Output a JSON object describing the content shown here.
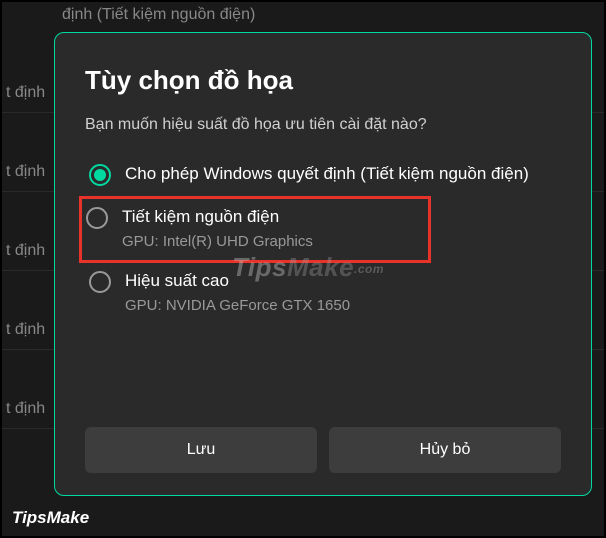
{
  "background": {
    "item0": "định (Tiết kiệm nguồn điện)",
    "item1": "t định",
    "item2": "t định",
    "item3": "t định",
    "item4": "t định",
    "item5": "t định"
  },
  "dialog": {
    "title": "Tùy chọn đồ họa",
    "subtitle": "Bạn muốn hiệu suất đồ họa ưu tiên cài đặt nào?",
    "options": [
      {
        "label": "Cho phép Windows quyết định (Tiết kiệm nguồn điện)",
        "sublabel": "",
        "checked": true,
        "highlighted": false
      },
      {
        "label": "Tiết kiệm nguồn điện",
        "sublabel": "GPU: Intel(R) UHD Graphics",
        "checked": false,
        "highlighted": true
      },
      {
        "label": "Hiệu suất cao",
        "sublabel": "GPU: NVIDIA GeForce GTX 1650",
        "checked": false,
        "highlighted": false
      }
    ],
    "buttons": {
      "save": "Lưu",
      "cancel": "Hủy bỏ"
    }
  },
  "watermark": {
    "tips": "Tips",
    "make": "Make",
    "com": ".com"
  },
  "footer": "TipsMake"
}
